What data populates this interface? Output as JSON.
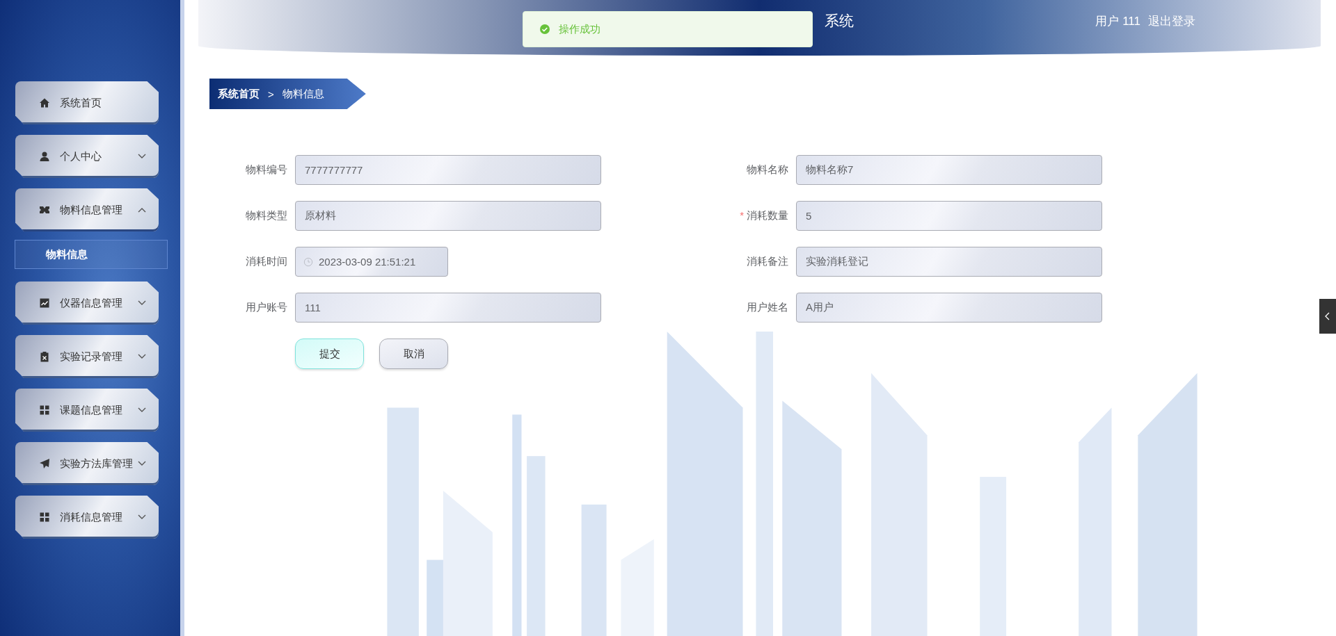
{
  "header": {
    "title": "系统",
    "user": "用户 111",
    "logout": "退出登录"
  },
  "toast": {
    "message": "操作成功"
  },
  "sidebar": {
    "items": [
      {
        "label": "系统首页",
        "kind": "link"
      },
      {
        "label": "个人中心",
        "kind": "group",
        "expanded": false
      },
      {
        "label": "物料信息管理",
        "kind": "group",
        "expanded": true,
        "children": [
          {
            "label": "物料信息",
            "selected": true
          }
        ]
      },
      {
        "label": "仪器信息管理",
        "kind": "group",
        "expanded": false
      },
      {
        "label": "实验记录管理",
        "kind": "group",
        "expanded": false
      },
      {
        "label": "课题信息管理",
        "kind": "group",
        "expanded": false
      },
      {
        "label": "实验方法库管理",
        "kind": "group",
        "expanded": false
      },
      {
        "label": "消耗信息管理",
        "kind": "group",
        "expanded": false
      }
    ]
  },
  "breadcrumb": [
    "系统首页",
    "物料信息"
  ],
  "breadcrumb_separator": ">",
  "form": {
    "required_mark": "*",
    "fields": [
      {
        "label": "物料编号",
        "value": "7777777777",
        "kind": "text",
        "required": false
      },
      {
        "label": "物料名称",
        "value": "物料名称7",
        "kind": "text",
        "required": false
      },
      {
        "label": "物料类型",
        "value": "原材料",
        "kind": "text",
        "required": false
      },
      {
        "label": "消耗数量",
        "value": "5",
        "kind": "text",
        "required": true
      },
      {
        "label": "消耗时间",
        "value": "2023-03-09 21:51:21",
        "kind": "datetime",
        "required": false
      },
      {
        "label": "消耗备注",
        "value": "实验消耗登记",
        "kind": "text",
        "required": false
      },
      {
        "label": "用户账号",
        "value": "111",
        "kind": "text",
        "required": false
      },
      {
        "label": "用户姓名",
        "value": "A用户",
        "kind": "text",
        "required": false
      }
    ],
    "buttons": [
      {
        "label": "提交",
        "kind": "primary"
      },
      {
        "label": "取消",
        "kind": "default"
      }
    ]
  }
}
